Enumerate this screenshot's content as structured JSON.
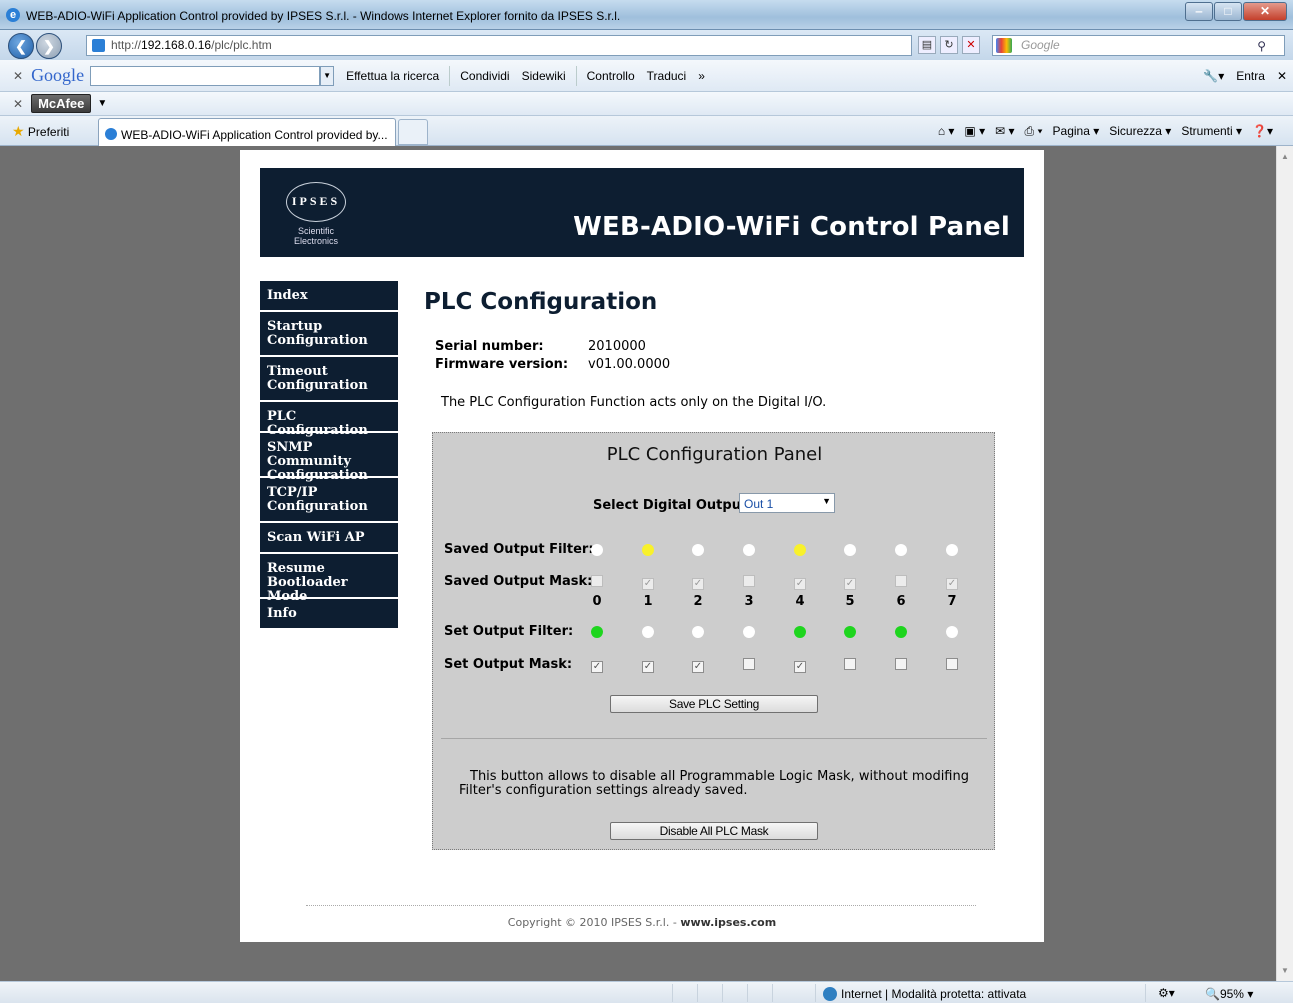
{
  "browser": {
    "window_title": "WEB-ADIO-WiFi Application Control provided by IPSES S.r.l. - Windows Internet Explorer fornito da IPSES S.r.l.",
    "url_prefix": "http://",
    "url_host": "192.168.0.16",
    "url_path": "/plc/plc.htm",
    "search_placeholder": "Google",
    "google_toolbar": {
      "logo": "Google",
      "items": [
        "Effettua la ricerca",
        "Condividi",
        "Sidewiki",
        "Controllo",
        "Traduci",
        "»"
      ],
      "login": "Entra"
    },
    "mcafee_label": "McAfee",
    "favorites_label": "Preferiti",
    "tab_title": "WEB-ADIO-WiFi Application Control provided by...",
    "command_items": [
      "Pagina ▾",
      "Sicurezza ▾",
      "Strumenti ▾"
    ],
    "status_zone": "Internet | Modalità protetta: attivata",
    "zoom": "95%"
  },
  "page": {
    "logo_text": "IPSES",
    "logo_sub1": "Scientific",
    "logo_sub2": "Electronics",
    "banner_title": "WEB-ADIO-WiFi Control Panel",
    "menu": [
      {
        "line1": "Index",
        "line2": ""
      },
      {
        "line1": "Startup",
        "line2": "Configuration"
      },
      {
        "line1": "Timeout",
        "line2": "Configuration"
      },
      {
        "line1": "PLC Configuration",
        "line2": ""
      },
      {
        "line1": "SNMP Community",
        "line2": "Configuration"
      },
      {
        "line1": "TCP/IP",
        "line2": "Configuration"
      },
      {
        "line1": "Scan WiFi AP",
        "line2": ""
      },
      {
        "line1": "Resume",
        "line2": "Bootloader Mode"
      },
      {
        "line1": "Info",
        "line2": ""
      }
    ],
    "title": "PLC Configuration",
    "serial_label": "Serial number:",
    "serial_value": "2010000",
    "firmware_label": "Firmware version:",
    "firmware_value": "v01.00.0000",
    "note": "The PLC Configuration Function acts only on the Digital I/O.",
    "panel": {
      "title": "PLC Configuration Panel",
      "select_label": "Select Digital Output:",
      "select_value": "Out 1",
      "saved_filter_label": "Saved Output Filter:",
      "saved_mask_label": "Saved Output Mask:",
      "set_filter_label": "Set Output Filter:",
      "set_mask_label": "Set Output Mask:",
      "bits": [
        "0",
        "1",
        "2",
        "3",
        "4",
        "5",
        "6",
        "7"
      ],
      "saved_filter": [
        "off",
        "yellow",
        "off",
        "off",
        "yellow",
        "off",
        "off",
        "off"
      ],
      "saved_mask": [
        false,
        true,
        true,
        false,
        true,
        true,
        false,
        true
      ],
      "set_filter": [
        "green",
        "off",
        "off",
        "off",
        "green",
        "green",
        "green",
        "off"
      ],
      "set_mask": [
        true,
        true,
        true,
        false,
        true,
        false,
        false,
        false
      ],
      "save_button": "Save PLC Setting",
      "disable_text": "This button allows to disable all Programmable Logic Mask, without modifing Filter's configuration settings already saved.",
      "disable_button": "Disable All PLC Mask"
    },
    "footer_prefix": "Copyright © 2010 IPSES S.r.l. - ",
    "footer_link": "www.ipses.com"
  }
}
